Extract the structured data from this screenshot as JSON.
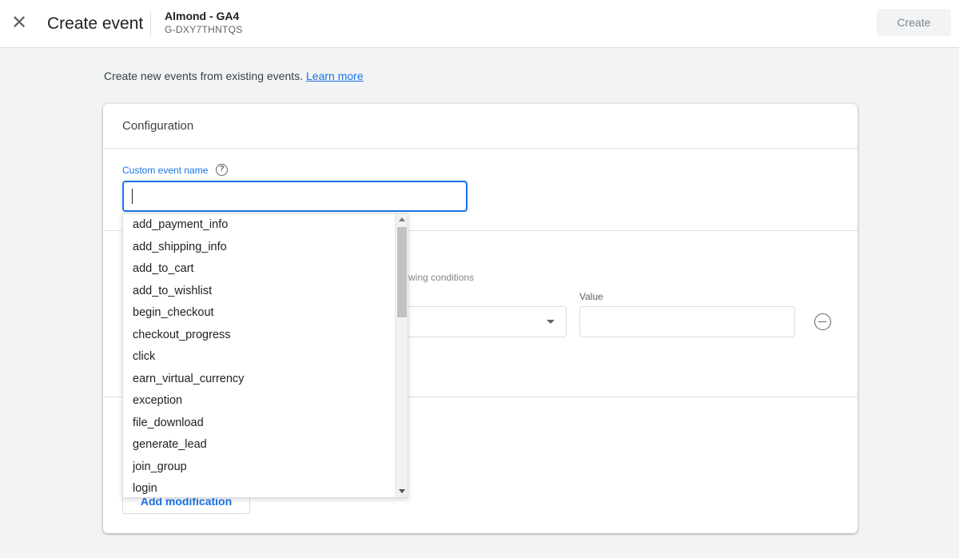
{
  "header": {
    "close_icon": "close-icon",
    "title": "Create event",
    "property_name": "Almond - GA4",
    "property_id": "G-DXY7THNTQS",
    "create_label": "Create"
  },
  "intro": {
    "text": "Create new events from existing events.",
    "link": "Learn more"
  },
  "config": {
    "title": "Configuration",
    "field_label": "Custom event name",
    "field_value": "",
    "conditions_text": "llowing conditions",
    "value_label": "Value",
    "add_modification_label": "Add modification"
  },
  "dropdown": {
    "options": [
      "add_payment_info",
      "add_shipping_info",
      "add_to_cart",
      "add_to_wishlist",
      "begin_checkout",
      "checkout_progress",
      "click",
      "earn_virtual_currency",
      "exception",
      "file_download",
      "generate_lead",
      "join_group",
      "login"
    ]
  },
  "colors": {
    "accent": "#1a73e8",
    "background": "#f1f3f4"
  }
}
